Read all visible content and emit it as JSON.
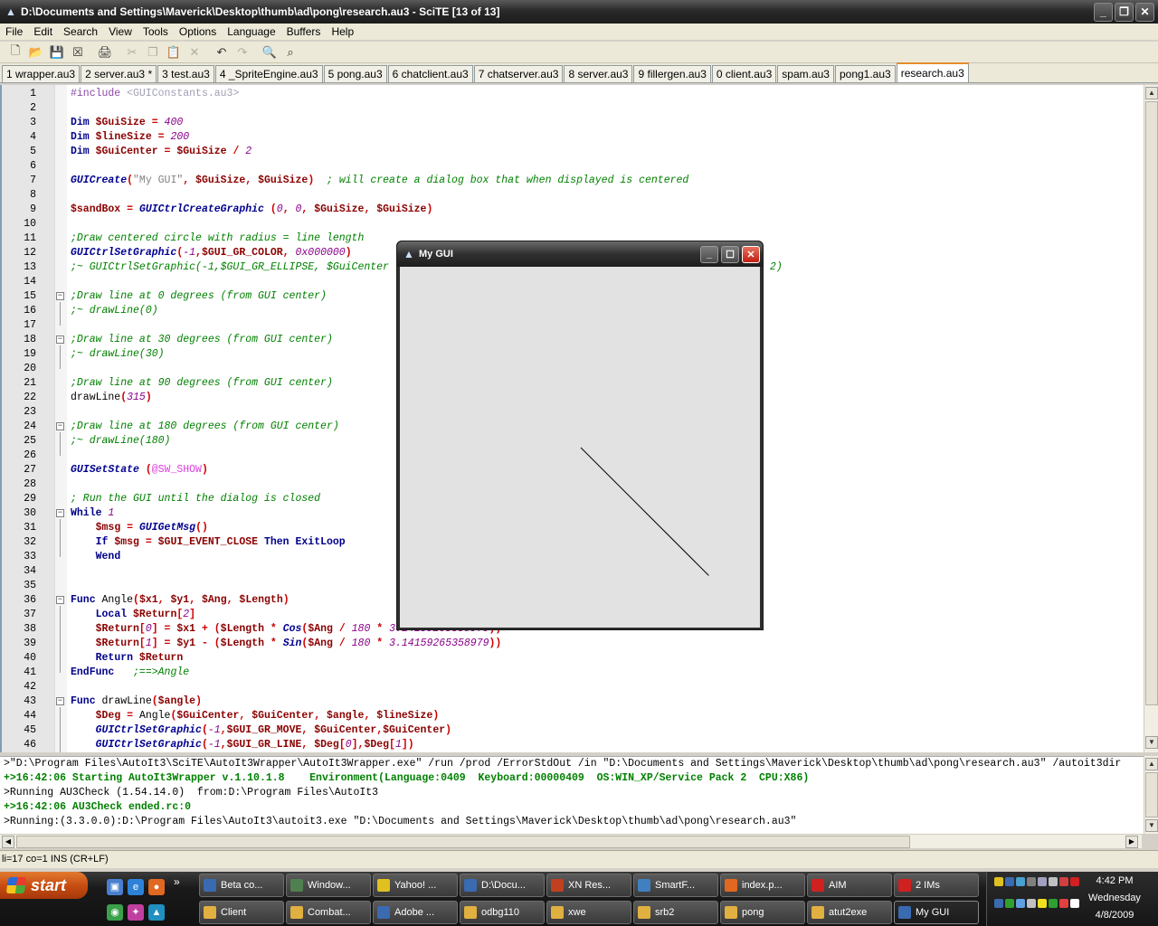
{
  "window": {
    "title": "D:\\Documents and Settings\\Maverick\\Desktop\\thumb\\ad\\pong\\research.au3 - SciTE [13 of 13]",
    "buttons": [
      "_",
      "❐",
      "✕"
    ]
  },
  "menu": [
    "File",
    "Edit",
    "Search",
    "View",
    "Tools",
    "Options",
    "Language",
    "Buffers",
    "Help"
  ],
  "toolbar": [
    {
      "name": "new-file-icon",
      "glyph": "🗋"
    },
    {
      "name": "open-file-icon",
      "glyph": "📂"
    },
    {
      "name": "save-icon",
      "glyph": "💾"
    },
    {
      "name": "close-file-icon",
      "glyph": "☒"
    },
    {
      "name": "sep"
    },
    {
      "name": "print-icon",
      "glyph": "🖨"
    },
    {
      "name": "sep"
    },
    {
      "name": "cut-icon",
      "glyph": "✂",
      "disabled": true
    },
    {
      "name": "copy-icon",
      "glyph": "❐",
      "disabled": true
    },
    {
      "name": "paste-icon",
      "glyph": "📋",
      "disabled": true
    },
    {
      "name": "delete-icon",
      "glyph": "✕",
      "disabled": true
    },
    {
      "name": "sep"
    },
    {
      "name": "undo-icon",
      "glyph": "↶"
    },
    {
      "name": "redo-icon",
      "glyph": "↷",
      "disabled": true
    },
    {
      "name": "sep"
    },
    {
      "name": "find-icon",
      "glyph": "🔍"
    },
    {
      "name": "replace-icon",
      "glyph": "⌕"
    }
  ],
  "tabs": [
    {
      "label": "1 wrapper.au3"
    },
    {
      "label": "2 server.au3 *"
    },
    {
      "label": "3 test.au3"
    },
    {
      "label": "4 _SpriteEngine.au3"
    },
    {
      "label": "5 pong.au3"
    },
    {
      "label": "6 chatclient.au3"
    },
    {
      "label": "7 chatserver.au3"
    },
    {
      "label": "8 server.au3"
    },
    {
      "label": "9 fillergen.au3"
    },
    {
      "label": "0 client.au3"
    },
    {
      "label": "spam.au3"
    },
    {
      "label": "pong1.au3"
    },
    {
      "label": "research.au3",
      "active": true
    }
  ],
  "code": [
    {
      "n": "1",
      "t": [
        [
          "dir",
          "#include "
        ],
        [
          "incl",
          "<GUIConstants.au3>"
        ]
      ]
    },
    {
      "n": "2",
      "t": []
    },
    {
      "n": "3",
      "t": [
        [
          "kw",
          "Dim "
        ],
        [
          "var",
          "$GuiSize"
        ],
        [
          "op",
          " = "
        ],
        [
          "num",
          "400"
        ]
      ]
    },
    {
      "n": "4",
      "t": [
        [
          "kw",
          "Dim "
        ],
        [
          "var",
          "$lineSize"
        ],
        [
          "op",
          " = "
        ],
        [
          "num",
          "200"
        ]
      ]
    },
    {
      "n": "5",
      "t": [
        [
          "kw",
          "Dim "
        ],
        [
          "var",
          "$GuiCenter"
        ],
        [
          "op",
          " = "
        ],
        [
          "var",
          "$GuiSize"
        ],
        [
          "op",
          " / "
        ],
        [
          "num",
          "2"
        ]
      ]
    },
    {
      "n": "6",
      "t": []
    },
    {
      "n": "7",
      "t": [
        [
          "fn",
          "GUICreate"
        ],
        [
          "op",
          "("
        ],
        [
          "str",
          "\"My GUI\""
        ],
        [
          "op",
          ", "
        ],
        [
          "var",
          "$GuiSize"
        ],
        [
          "op",
          ", "
        ],
        [
          "var",
          "$GuiSize"
        ],
        [
          "op",
          ")  "
        ],
        [
          "cm",
          "; will create a dialog box that when displayed is centered"
        ]
      ]
    },
    {
      "n": "8",
      "t": []
    },
    {
      "n": "9",
      "t": [
        [
          "var",
          "$sandBox"
        ],
        [
          "op",
          " = "
        ],
        [
          "fn",
          "GUICtrlCreateGraphic"
        ],
        [
          "op",
          " ("
        ],
        [
          "num",
          "0"
        ],
        [
          "op",
          ", "
        ],
        [
          "num",
          "0"
        ],
        [
          "op",
          ", "
        ],
        [
          "var",
          "$GuiSize"
        ],
        [
          "op",
          ", "
        ],
        [
          "var",
          "$GuiSize"
        ],
        [
          "op",
          ")"
        ]
      ]
    },
    {
      "n": "10",
      "t": []
    },
    {
      "n": "11",
      "t": [
        [
          "cm",
          ";Draw centered circle with radius = line length"
        ]
      ]
    },
    {
      "n": "12",
      "t": [
        [
          "fn",
          "GUICtrlSetGraphic"
        ],
        [
          "op",
          "("
        ],
        [
          "num",
          "-1"
        ],
        [
          "op",
          ","
        ],
        [
          "var",
          "$GUI_GR_COLOR"
        ],
        [
          "op",
          ", "
        ],
        [
          "num",
          "0x000000"
        ],
        [
          "op",
          ")"
        ]
      ]
    },
    {
      "n": "13",
      "t": [
        [
          "cm",
          ";~ GUICtrlSetGraphic(-1,$GUI_GR_ELLIPSE, $GuiCenter                                                      Size * 2)"
        ]
      ]
    },
    {
      "n": "14",
      "t": []
    },
    {
      "n": "15",
      "fold": "-",
      "t": [
        [
          "cm",
          ";Draw line at 0 degrees (from GUI center)"
        ]
      ]
    },
    {
      "n": "16",
      "t": [
        [
          "cm",
          ";~ drawLine(0)"
        ]
      ]
    },
    {
      "n": "17",
      "t": []
    },
    {
      "n": "18",
      "fold": "-",
      "t": [
        [
          "cm",
          ";Draw line at 30 degrees (from GUI center)"
        ]
      ]
    },
    {
      "n": "19",
      "t": [
        [
          "cm",
          ";~ drawLine(30)"
        ]
      ]
    },
    {
      "n": "20",
      "t": []
    },
    {
      "n": "21",
      "t": [
        [
          "cm",
          ";Draw line at 90 degrees (from GUI center)"
        ]
      ]
    },
    {
      "n": "22",
      "t": [
        [
          "udf",
          "drawLine"
        ],
        [
          "op",
          "("
        ],
        [
          "num",
          "315"
        ],
        [
          "op",
          ")"
        ]
      ]
    },
    {
      "n": "23",
      "t": []
    },
    {
      "n": "24",
      "fold": "-",
      "t": [
        [
          "cm",
          ";Draw line at 180 degrees (from GUI center)"
        ]
      ]
    },
    {
      "n": "25",
      "t": [
        [
          "cm",
          ";~ drawLine(180)"
        ]
      ]
    },
    {
      "n": "26",
      "t": []
    },
    {
      "n": "27",
      "t": [
        [
          "fn",
          "GUISetState"
        ],
        [
          "op",
          " ("
        ],
        [
          "mac",
          "@SW_SHOW"
        ],
        [
          "op",
          ")"
        ]
      ]
    },
    {
      "n": "28",
      "t": []
    },
    {
      "n": "29",
      "t": [
        [
          "cm",
          "; Run the GUI until the dialog is closed"
        ]
      ]
    },
    {
      "n": "30",
      "fold": "-",
      "t": [
        [
          "kw",
          "While "
        ],
        [
          "num",
          "1"
        ]
      ]
    },
    {
      "n": "31",
      "t": [
        [
          "plain",
          "    "
        ],
        [
          "var",
          "$msg"
        ],
        [
          "op",
          " = "
        ],
        [
          "fn",
          "GUIGetMsg"
        ],
        [
          "op",
          "()"
        ]
      ]
    },
    {
      "n": "32",
      "t": [
        [
          "plain",
          "    "
        ],
        [
          "kw",
          "If "
        ],
        [
          "var",
          "$msg"
        ],
        [
          "op",
          " = "
        ],
        [
          "var",
          "$GUI_EVENT_CLOSE"
        ],
        [
          "kw",
          " Then ExitLoop"
        ]
      ]
    },
    {
      "n": "33",
      "t": [
        [
          "plain",
          "    "
        ],
        [
          "kw",
          "Wend"
        ]
      ]
    },
    {
      "n": "34",
      "t": []
    },
    {
      "n": "35",
      "t": []
    },
    {
      "n": "36",
      "fold": "-",
      "t": [
        [
          "kw",
          "Func "
        ],
        [
          "udf",
          "Angle"
        ],
        [
          "op",
          "("
        ],
        [
          "var",
          "$x1"
        ],
        [
          "op",
          ", "
        ],
        [
          "var",
          "$y1"
        ],
        [
          "op",
          ", "
        ],
        [
          "var",
          "$Ang"
        ],
        [
          "op",
          ", "
        ],
        [
          "var",
          "$Length"
        ],
        [
          "op",
          ")"
        ]
      ]
    },
    {
      "n": "37",
      "t": [
        [
          "plain",
          "    "
        ],
        [
          "kw",
          "Local "
        ],
        [
          "var",
          "$Return"
        ],
        [
          "op",
          "["
        ],
        [
          "num",
          "2"
        ],
        [
          "op",
          "]"
        ]
      ]
    },
    {
      "n": "38",
      "t": [
        [
          "plain",
          "    "
        ],
        [
          "var",
          "$Return"
        ],
        [
          "op",
          "["
        ],
        [
          "num",
          "0"
        ],
        [
          "op",
          "] = "
        ],
        [
          "var",
          "$x1"
        ],
        [
          "op",
          " + ("
        ],
        [
          "var",
          "$Length"
        ],
        [
          "op",
          " * "
        ],
        [
          "fn",
          "Cos"
        ],
        [
          "op",
          "("
        ],
        [
          "var",
          "$Ang"
        ],
        [
          "op",
          " / "
        ],
        [
          "num",
          "180"
        ],
        [
          "op",
          " * "
        ],
        [
          "num",
          "3.14159265358979"
        ],
        [
          "op",
          "))"
        ]
      ]
    },
    {
      "n": "39",
      "t": [
        [
          "plain",
          "    "
        ],
        [
          "var",
          "$Return"
        ],
        [
          "op",
          "["
        ],
        [
          "num",
          "1"
        ],
        [
          "op",
          "] = "
        ],
        [
          "var",
          "$y1"
        ],
        [
          "op",
          " - ("
        ],
        [
          "var",
          "$Length"
        ],
        [
          "op",
          " * "
        ],
        [
          "fn",
          "Sin"
        ],
        [
          "op",
          "("
        ],
        [
          "var",
          "$Ang"
        ],
        [
          "op",
          " / "
        ],
        [
          "num",
          "180"
        ],
        [
          "op",
          " * "
        ],
        [
          "num",
          "3.14159265358979"
        ],
        [
          "op",
          "))"
        ]
      ]
    },
    {
      "n": "40",
      "t": [
        [
          "plain",
          "    "
        ],
        [
          "kw",
          "Return "
        ],
        [
          "var",
          "$Return"
        ]
      ]
    },
    {
      "n": "41",
      "t": [
        [
          "kw",
          "EndFunc"
        ],
        [
          "plain",
          "   "
        ],
        [
          "cm",
          ";==>Angle"
        ]
      ]
    },
    {
      "n": "42",
      "t": []
    },
    {
      "n": "43",
      "fold": "-",
      "t": [
        [
          "kw",
          "Func "
        ],
        [
          "udf",
          "drawLine"
        ],
        [
          "op",
          "("
        ],
        [
          "var",
          "$angle"
        ],
        [
          "op",
          ")"
        ]
      ]
    },
    {
      "n": "44",
      "t": [
        [
          "plain",
          "    "
        ],
        [
          "var",
          "$Deg"
        ],
        [
          "op",
          " = "
        ],
        [
          "udf",
          "Angle"
        ],
        [
          "op",
          "("
        ],
        [
          "var",
          "$GuiCenter"
        ],
        [
          "op",
          ", "
        ],
        [
          "var",
          "$GuiCenter"
        ],
        [
          "op",
          ", "
        ],
        [
          "var",
          "$angle"
        ],
        [
          "op",
          ", "
        ],
        [
          "var",
          "$lineSize"
        ],
        [
          "op",
          ")"
        ]
      ]
    },
    {
      "n": "45",
      "t": [
        [
          "plain",
          "    "
        ],
        [
          "fn",
          "GUICtrlSetGraphic"
        ],
        [
          "op",
          "("
        ],
        [
          "num",
          "-1"
        ],
        [
          "op",
          ","
        ],
        [
          "var",
          "$GUI_GR_MOVE"
        ],
        [
          "op",
          ", "
        ],
        [
          "var",
          "$GuiCenter"
        ],
        [
          "op",
          ","
        ],
        [
          "var",
          "$GuiCenter"
        ],
        [
          "op",
          ")"
        ]
      ]
    },
    {
      "n": "46",
      "t": [
        [
          "plain",
          "    "
        ],
        [
          "fn",
          "GUICtrlSetGraphic"
        ],
        [
          "op",
          "("
        ],
        [
          "num",
          "-1"
        ],
        [
          "op",
          ","
        ],
        [
          "var",
          "$GUI_GR_LINE"
        ],
        [
          "op",
          ", "
        ],
        [
          "var",
          "$Deg"
        ],
        [
          "op",
          "["
        ],
        [
          "num",
          "0"
        ],
        [
          "op",
          "],"
        ],
        [
          "var",
          "$Deg"
        ],
        [
          "op",
          "["
        ],
        [
          "num",
          "1"
        ],
        [
          "op",
          "])"
        ]
      ]
    }
  ],
  "output": [
    {
      "cls": "norm",
      "text": ">\"D:\\Program Files\\AutoIt3\\SciTE\\AutoIt3Wrapper\\AutoIt3Wrapper.exe\" /run /prod /ErrorStdOut /in \"D:\\Documents and Settings\\Maverick\\Desktop\\thumb\\ad\\pong\\research.au3\" /autoit3dir"
    },
    {
      "cls": "ok",
      "text": "+>16:42:06 Starting AutoIt3Wrapper v.1.10.1.8    Environment(Language:0409  Keyboard:00000409  OS:WIN_XP/Service Pack 2  CPU:X86)"
    },
    {
      "cls": "norm",
      "text": ">Running AU3Check (1.54.14.0)  from:D:\\Program Files\\AutoIt3"
    },
    {
      "cls": "ok",
      "text": "+>16:42:06 AU3Check ended.rc:0"
    },
    {
      "cls": "norm",
      "text": ">Running:(3.3.0.0):D:\\Program Files\\AutoIt3\\autoit3.exe \"D:\\Documents and Settings\\Maverick\\Desktop\\thumb\\ad\\pong\\research.au3\""
    }
  ],
  "status": "li=17 co=1 INS (CR+LF)",
  "gui": {
    "title": "My GUI",
    "buttons": [
      "_",
      "☐",
      "✕"
    ],
    "line": {
      "angle": 315,
      "length": 200
    }
  },
  "taskbar": {
    "start": "start",
    "quicklaunch": [
      {
        "name": "desktop-icon",
        "color": "#4a7fd0",
        "glyph": "▣"
      },
      {
        "name": "ie-icon",
        "color": "#2d82d8",
        "glyph": "e"
      },
      {
        "name": "firefox-icon",
        "color": "#e06820",
        "glyph": "●"
      },
      {
        "name": "chrome-icon",
        "color": "#3aa04a",
        "glyph": "◉"
      },
      {
        "name": "app-icon",
        "color": "#c040a0",
        "glyph": "✦"
      },
      {
        "name": "app2-icon",
        "color": "#2090c0",
        "glyph": "▲"
      }
    ],
    "row1": [
      {
        "label": "Beta co...",
        "color": "#3a6ab0"
      },
      {
        "label": "Window...",
        "color": "#508050"
      },
      {
        "label": "Yahoo! ...",
        "color": "#e0c020"
      },
      {
        "label": "D:\\Docu...",
        "color": "#3a6ab0"
      },
      {
        "label": "XN Res...",
        "color": "#c04020"
      },
      {
        "label": "SmartF...",
        "color": "#4080c0"
      },
      {
        "label": "index.p...",
        "color": "#e06820"
      },
      {
        "label": "AIM",
        "color": "#d02020"
      },
      {
        "label": "2 IMs",
        "color": "#d02020"
      }
    ],
    "row2": [
      {
        "label": "Client",
        "color": "#e0b040"
      },
      {
        "label": "Combat...",
        "color": "#e0b040"
      },
      {
        "label": "Adobe ...",
        "color": "#3a6ab0"
      },
      {
        "label": "odbg110",
        "color": "#e0b040"
      },
      {
        "label": "xwe",
        "color": "#e0b040"
      },
      {
        "label": "srb2",
        "color": "#e0b040"
      },
      {
        "label": "pong",
        "color": "#e0b040"
      },
      {
        "label": "atut2exe",
        "color": "#e0b040"
      },
      {
        "label": "My GUI",
        "color": "#3a6ab0",
        "active": true
      }
    ],
    "time": "4:42 PM",
    "day": "Wednesday",
    "date": "4/8/2009"
  }
}
